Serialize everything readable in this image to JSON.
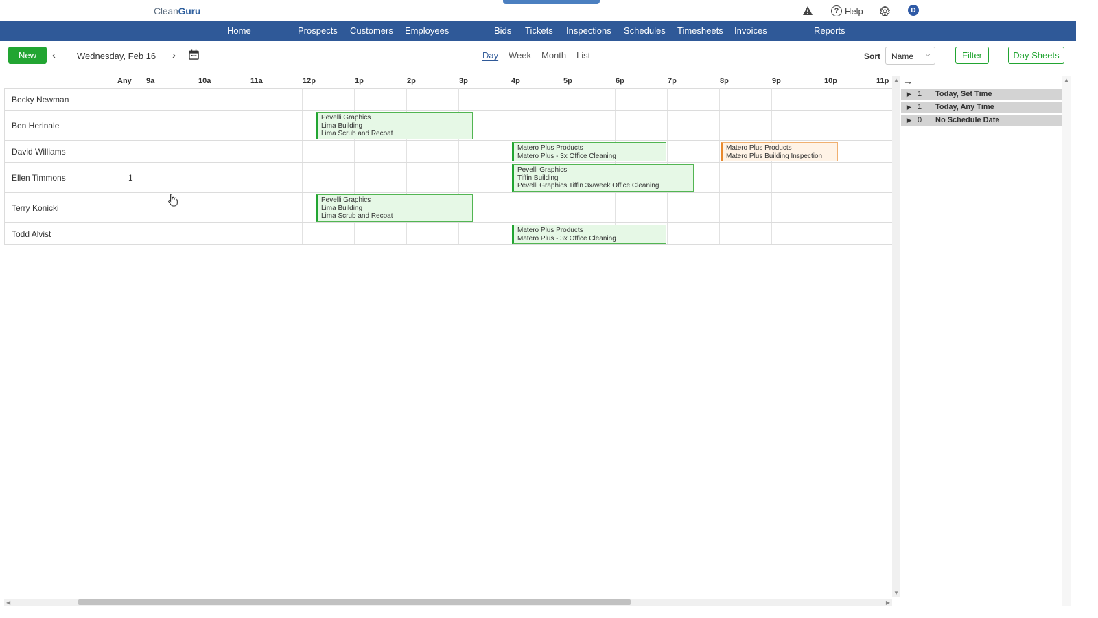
{
  "app": {
    "logo_part1": "Clean",
    "logo_part2": "Guru",
    "help_label": "Help",
    "avatar_initial": "D"
  },
  "nav": {
    "items": [
      "Home",
      "Prospects",
      "Customers",
      "Employees",
      "Bids",
      "Tickets",
      "Inspections",
      "Schedules",
      "Timesheets",
      "Invoices",
      "Reports"
    ],
    "active": "Schedules"
  },
  "toolbar": {
    "new_label": "New",
    "date_label": "Wednesday, Feb 16",
    "views": [
      "Day",
      "Week",
      "Month",
      "List"
    ],
    "active_view": "Day",
    "sort_label": "Sort",
    "sort_value": "Name",
    "filter_label": "Filter",
    "day_sheets_label": "Day Sheets"
  },
  "grid": {
    "columns": [
      "Any",
      "9a",
      "10a",
      "11a",
      "12p",
      "1p",
      "2p",
      "3p",
      "4p",
      "5p",
      "6p",
      "7p",
      "8p",
      "9p",
      "10p",
      "11p"
    ],
    "employees": [
      {
        "name": "Becky Newman",
        "any": ""
      },
      {
        "name": "Ben Herinale",
        "any": ""
      },
      {
        "name": "David Williams",
        "any": ""
      },
      {
        "name": "Ellen Timmons",
        "any": "1"
      },
      {
        "name": "Terry Konicki",
        "any": ""
      },
      {
        "name": "Todd Alvist",
        "any": ""
      }
    ],
    "events": [
      {
        "lines": [
          "Pevelli Graphics",
          "Lima Building",
          "Lima Scrub and Recoat"
        ],
        "status": "green"
      },
      {
        "lines": [
          "Matero Plus Products",
          "Matero Plus - 3x Office Cleaning"
        ],
        "status": "green"
      },
      {
        "lines": [
          "Matero Plus Products",
          "Matero Plus Building Inspection"
        ],
        "status": "orange"
      },
      {
        "lines": [
          "Pevelli Graphics",
          "Tiffin Building",
          "Pevelli Graphics Tiffin 3x/week Office Cleaning"
        ],
        "status": "green"
      },
      {
        "lines": [
          "Pevelli Graphics",
          "Lima Building",
          "Lima Scrub and Recoat"
        ],
        "status": "green"
      },
      {
        "lines": [
          "Matero Plus Products",
          "Matero Plus - 3x Office Cleaning"
        ],
        "status": "green"
      }
    ]
  },
  "panel": {
    "groups": [
      {
        "count": "1",
        "label": "Today, Set Time"
      },
      {
        "count": "1",
        "label": "Today, Any Time"
      },
      {
        "count": "0",
        "label": "No Schedule Date"
      }
    ]
  },
  "colors": {
    "nav_bg": "#2f5998",
    "accent_green": "#22a532",
    "event_green_bg": "#e6f8e6",
    "event_orange_border": "#e8892e"
  }
}
